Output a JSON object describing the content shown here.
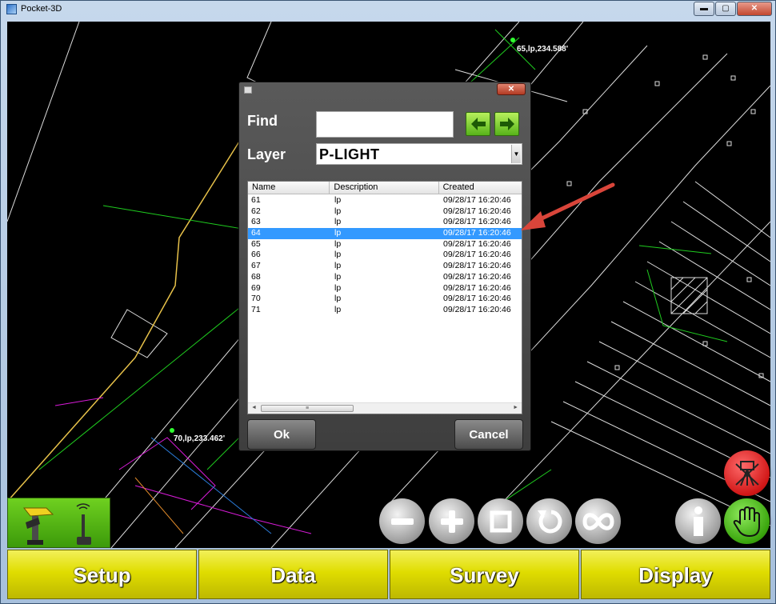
{
  "window": {
    "title": "Pocket-3D",
    "minimize": "▬",
    "maximize": "▢",
    "close": "✕"
  },
  "map": {
    "labels": [
      "65,lp,234.588'",
      "70,lp,233.462'"
    ]
  },
  "dialog": {
    "close": "✕",
    "find_label": "Find",
    "find_value": "",
    "layer_label": "Layer",
    "layer_value": "P-LIGHT",
    "columns": [
      "Name",
      "Description",
      "Created"
    ],
    "rows": [
      {
        "name": "61",
        "description": "lp",
        "created": "09/28/17 16:20:46"
      },
      {
        "name": "62",
        "description": "lp",
        "created": "09/28/17 16:20:46"
      },
      {
        "name": "63",
        "description": "lp",
        "created": "09/28/17 16:20:46"
      },
      {
        "name": "64",
        "description": "lp",
        "created": "09/28/17 16:20:46"
      },
      {
        "name": "65",
        "description": "lp",
        "created": "09/28/17 16:20:46"
      },
      {
        "name": "66",
        "description": "lp",
        "created": "09/28/17 16:20:46"
      },
      {
        "name": "67",
        "description": "lp",
        "created": "09/28/17 16:20:46"
      },
      {
        "name": "68",
        "description": "lp",
        "created": "09/28/17 16:20:46"
      },
      {
        "name": "69",
        "description": "lp",
        "created": "09/28/17 16:20:46"
      },
      {
        "name": "70",
        "description": "lp",
        "created": "09/28/17 16:20:46"
      },
      {
        "name": "71",
        "description": "lp",
        "created": "09/28/17 16:20:46"
      }
    ],
    "selected_row": "64",
    "ok_label": "Ok",
    "cancel_label": "Cancel"
  },
  "toolbar": {
    "tabs": [
      "Setup",
      "Data",
      "Survey",
      "Display"
    ]
  },
  "colors": {
    "selection": "#3399ff",
    "tab_yellow": "#e0dd00",
    "accent_green": "#57b31a",
    "callout_red": "#d9453a"
  }
}
